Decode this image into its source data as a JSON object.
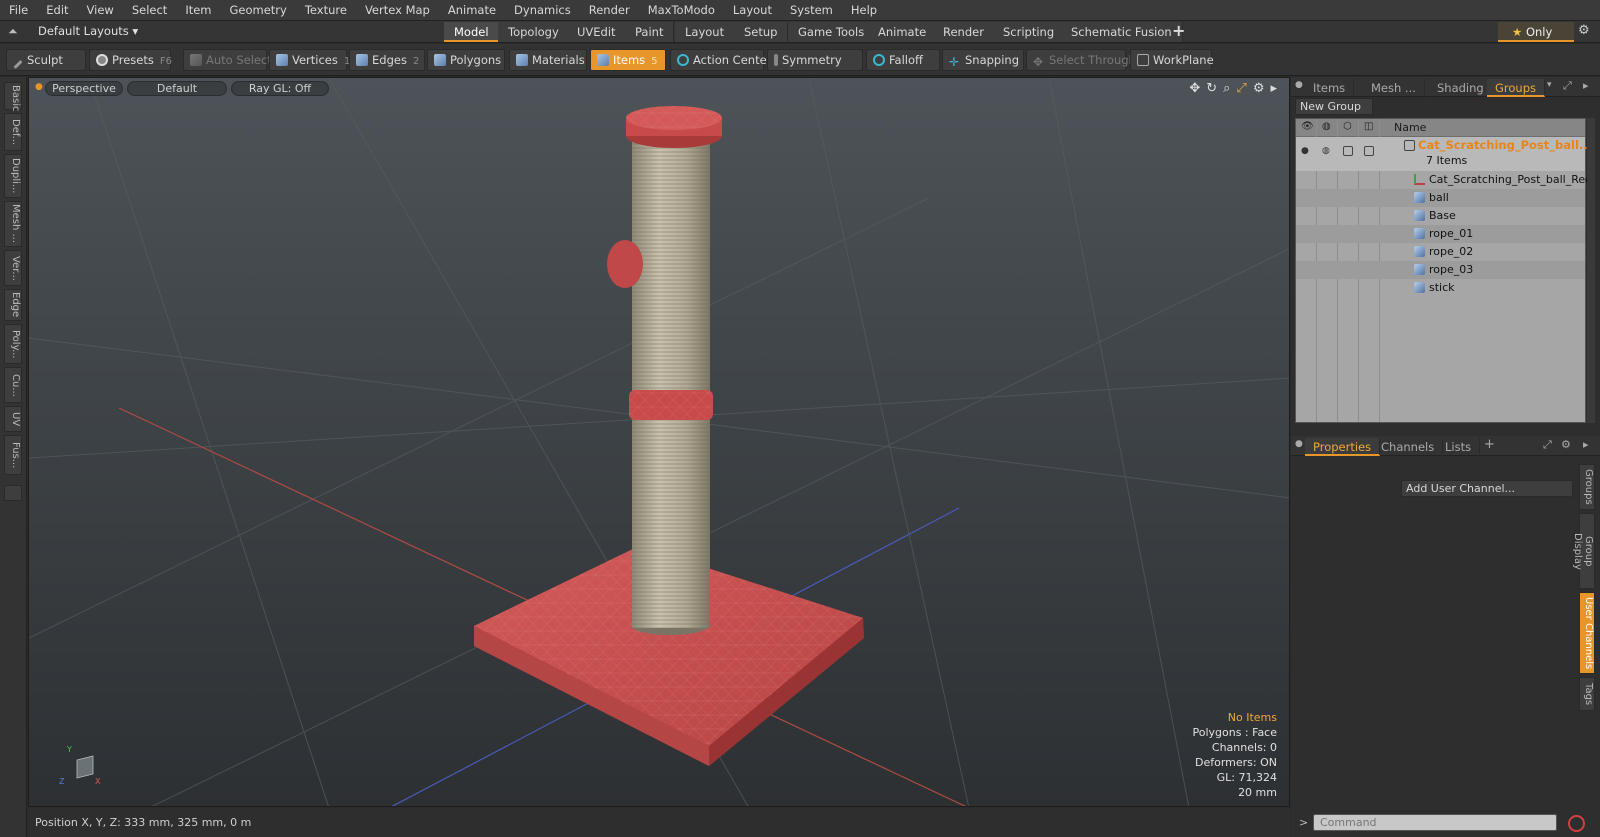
{
  "menu": [
    "File",
    "Edit",
    "View",
    "Select",
    "Item",
    "Geometry",
    "Texture",
    "Vertex Map",
    "Animate",
    "Dynamics",
    "Render",
    "MaxToModo",
    "Layout",
    "System",
    "Help"
  ],
  "layout_selector": "Default Layouts ▾",
  "layout_tabs": [
    "Model",
    "Topology",
    "UVEdit",
    "Paint",
    "Layout",
    "Setup",
    "Game Tools",
    "Animate",
    "Render",
    "Scripting",
    "Schematic Fusion"
  ],
  "only_label": "Only",
  "toolbar": {
    "sculpt": "Sculpt",
    "presets": "Presets",
    "presets_key": "F6",
    "auto_select": "Auto Select",
    "vertices": "Vertices",
    "vertices_key": "1",
    "edges": "Edges",
    "edges_key": "2",
    "polygons": "Polygons",
    "materials": "Materials",
    "items": "Items",
    "items_key": "5",
    "action_center": "Action Center",
    "symmetry": "Symmetry",
    "falloff": "Falloff",
    "snapping": "Snapping",
    "select_through": "Select Through",
    "workplane": "WorkPlane"
  },
  "left_tabs": [
    "Basic",
    "Def...",
    "Dupli...",
    "Mesh ...",
    "Ver...",
    "Edge",
    "Poly...",
    "Cu...",
    "UV",
    "Fus..."
  ],
  "viewport": {
    "view_mode": "Perspective",
    "shading": "Default",
    "raygl": "Ray GL: Off",
    "info": {
      "selection": "No Items",
      "polygons": "Polygons : Face",
      "channels": "Channels: 0",
      "deformers": "Deformers: ON",
      "gl": "GL: 71,324",
      "scale": "20 mm"
    }
  },
  "status": "Position X, Y, Z:  333 mm, 325 mm, 0 m",
  "right_panel": {
    "tabs": [
      "Items",
      "Mesh ...",
      "Shading",
      "Groups"
    ],
    "active_tab": "Groups",
    "new_group": "New Group",
    "name_header": "Name",
    "tree": {
      "root": "Cat_Scratching_Post_ball...",
      "count": "7 Items",
      "children": [
        "Cat_Scratching_Post_ball_Red",
        "ball",
        "Base",
        "rope_01",
        "rope_02",
        "rope_03",
        "stick"
      ]
    },
    "bottom_tabs": [
      "Properties",
      "Channels",
      "Lists"
    ],
    "add_user_channel": "Add User Channel...",
    "side_tabs": [
      "Groups",
      "Group Display",
      "User Channels",
      "Tags"
    ],
    "command_placeholder": "Command"
  },
  "colors": {
    "accent": "#e8962a",
    "post_red": "#c84a4a",
    "rope": "#b8b09a"
  }
}
